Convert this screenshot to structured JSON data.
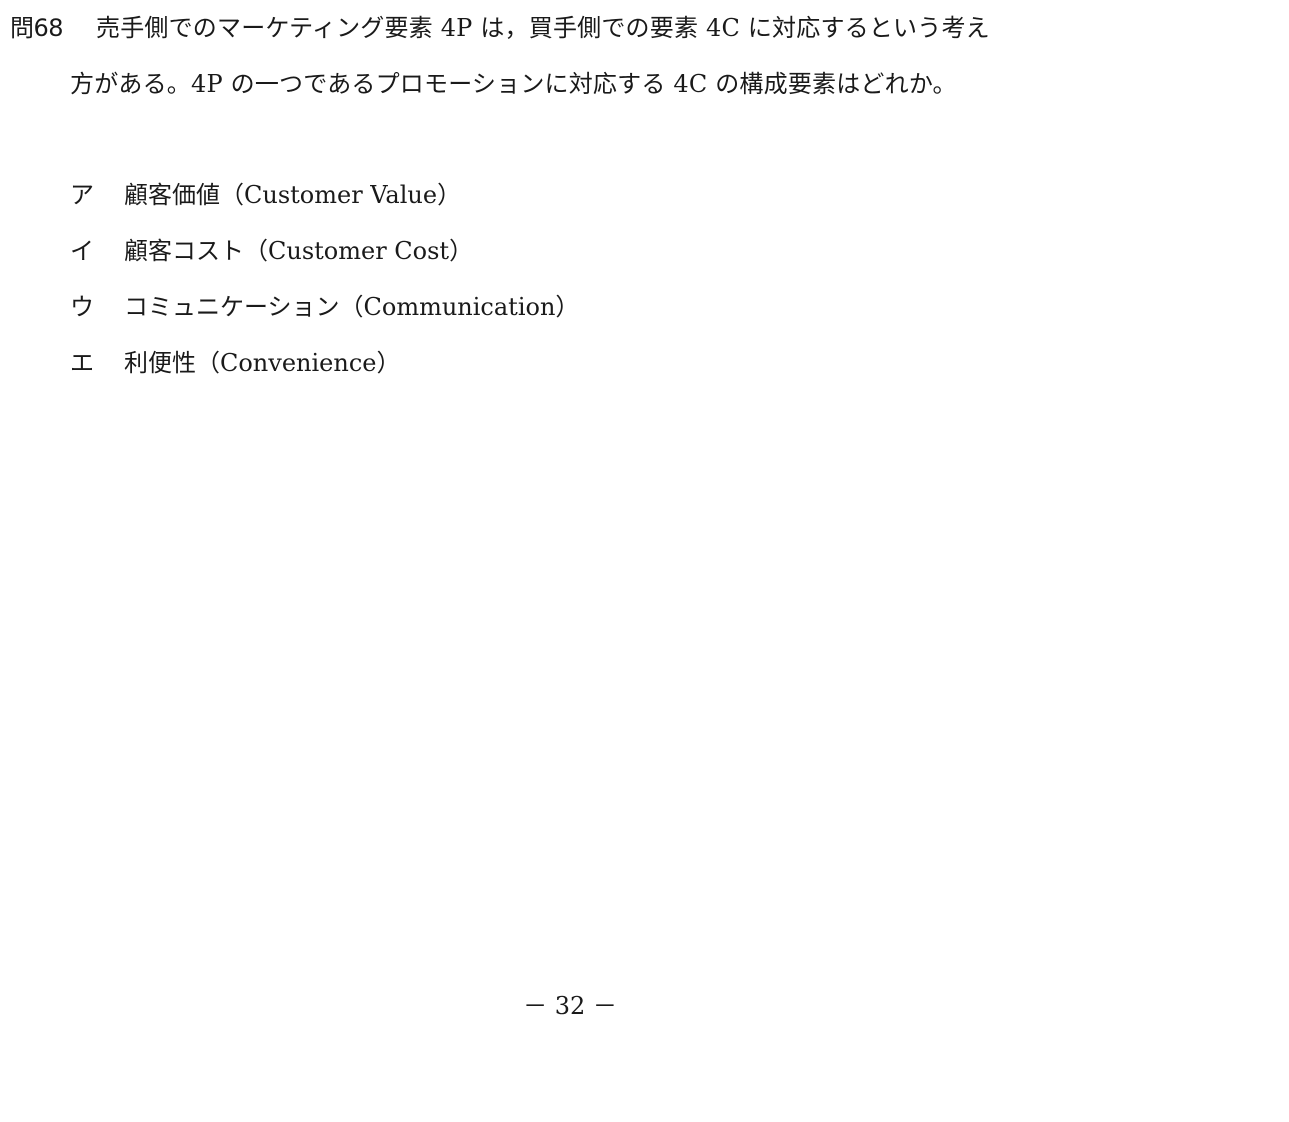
{
  "question": {
    "number": "問68",
    "line1": "売手側でのマーケティング要素 4P は，買手側での要素 4C に対応するという考え",
    "line2": "方がある。4P の一つであるプロモーションに対応する 4C の構成要素はどれか。"
  },
  "options": [
    {
      "letter": "ア",
      "text": "顧客価値（Customer Value）"
    },
    {
      "letter": "イ",
      "text": "顧客コスト（Customer Cost）"
    },
    {
      "letter": "ウ",
      "text": "コミュニケーション（Communication）"
    },
    {
      "letter": "エ",
      "text": "利便性（Convenience）"
    }
  ],
  "footer": {
    "page_number": "－ 32 －"
  }
}
